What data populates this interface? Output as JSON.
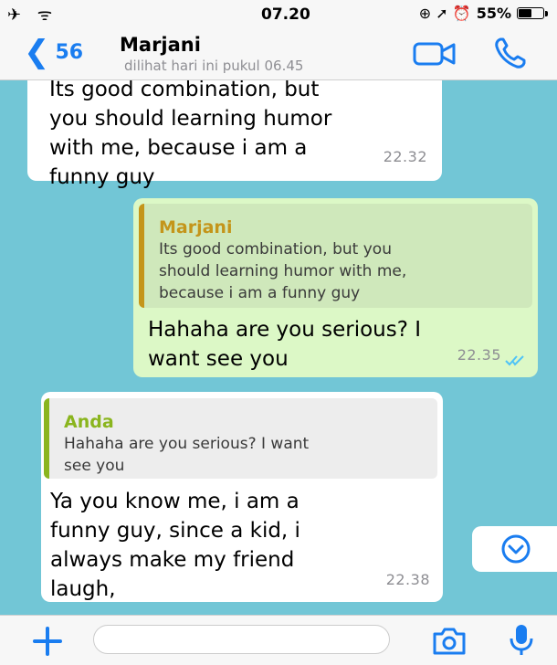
{
  "status_bar": {
    "left_icons": "✈ ᯤ",
    "time": "07.20",
    "right_icons": "⊕ ➚ ⏰",
    "battery_percent": "55%",
    "battery_level": 0.55
  },
  "header": {
    "back_chevron": "❮",
    "back_count": "56",
    "contact_name": "Marjani",
    "last_seen": "dilihat hari ini pukul 06.45",
    "video_icon": "video-camera-icon",
    "call_icon": "phone-icon"
  },
  "messages": [
    {
      "direction": "incoming",
      "lines": [
        "Its good combination, but",
        "you should learning humor",
        "with me, because i am a",
        "funny guy"
      ],
      "time": "22.32"
    },
    {
      "direction": "outgoing",
      "quote": {
        "name": "Marjani",
        "lines": [
          "Its good combination, but you",
          "should learning humor with me,",
          "because i am a funny guy"
        ]
      },
      "lines": [
        "Hahaha are you serious? I",
        "want see you"
      ],
      "time": "22.35",
      "status": "read"
    },
    {
      "direction": "incoming",
      "quote": {
        "name": "Anda",
        "lines": [
          "Hahaha are you serious? I want",
          "see you"
        ]
      },
      "lines": [
        "Ya you know me,  i am a",
        "funny guy, since a kid, i",
        "always make my friend",
        "laugh,"
      ],
      "time": "22.38"
    }
  ],
  "colors": {
    "chat_background": "#72c6d6",
    "outgoing_bubble": "#dcf8c6",
    "quote_marjani": "#c4951a",
    "quote_anda": "#8ab51e",
    "accent_blue": "#1a7df0",
    "read_ticks": "#4fc3f7"
  },
  "composer": {
    "plus_icon": "plus-icon",
    "camera_icon": "camera-icon",
    "mic_icon": "microphone-icon",
    "input_value": ""
  },
  "scroll_button_icon": "chevron-down-circle-icon"
}
